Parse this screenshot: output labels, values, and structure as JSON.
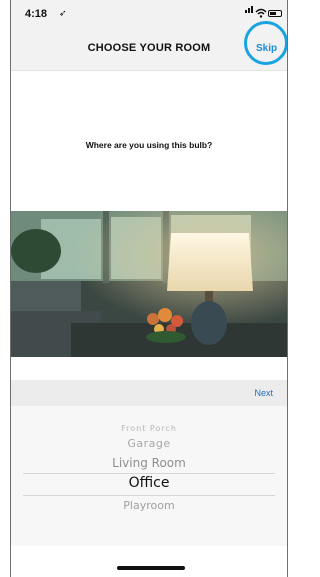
{
  "status_bar": {
    "time": "4:18",
    "location_glyph": "➶"
  },
  "header": {
    "title": "CHOOSE YOUR ROOM",
    "skip_label": "Skip",
    "accent": "#1aa3e0"
  },
  "question": "Where are you using this bulb?",
  "photo": {
    "description_icon": "room-photo"
  },
  "toolbar": {
    "next_label": "Next"
  },
  "picker": {
    "options": [
      "Front Porch",
      "Garage",
      "Living Room",
      "Office",
      "Playroom"
    ],
    "selected": "Office"
  }
}
